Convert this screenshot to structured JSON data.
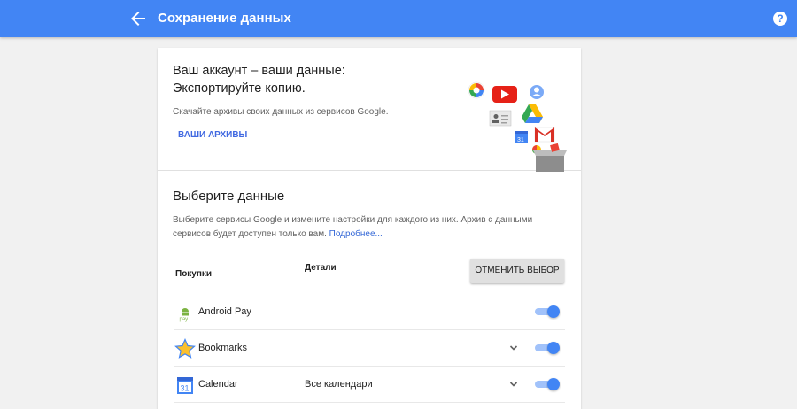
{
  "header": {
    "title": "Сохранение данных",
    "help_label": "?",
    "color": "#4285f4"
  },
  "hero": {
    "title_line1": "Ваш аккаунт – ваши данные:",
    "title_line2": "Экспортируйте копию.",
    "description": "Скачайте архивы своих данных из сервисов Google.",
    "archives_link": "ВАШИ АРХИВЫ"
  },
  "select": {
    "title": "Выберите данные",
    "description": "Выберите сервисы Google и измените настройки для каждого из них. Архив с данными сервисов будет доступен только вам.",
    "more_link": "Подробнее..."
  },
  "table": {
    "col_products": "Покупки",
    "col_details": "Детали",
    "deselect_label": "ОТМЕНИТЬ ВЫБОР",
    "rows": [
      {
        "name": "Android Pay",
        "detail": "",
        "icon": "android-pay-icon",
        "enabled": true,
        "expandable": false
      },
      {
        "name": "Bookmarks",
        "detail": "",
        "icon": "star-icon",
        "enabled": true,
        "expandable": true
      },
      {
        "name": "Calendar",
        "detail": "Все календари",
        "icon": "calendar-icon",
        "enabled": true,
        "expandable": true
      }
    ]
  },
  "colors": {
    "accent": "#4285f4",
    "link": "#3367d6",
    "toggle_track": "#a1c2fa"
  }
}
